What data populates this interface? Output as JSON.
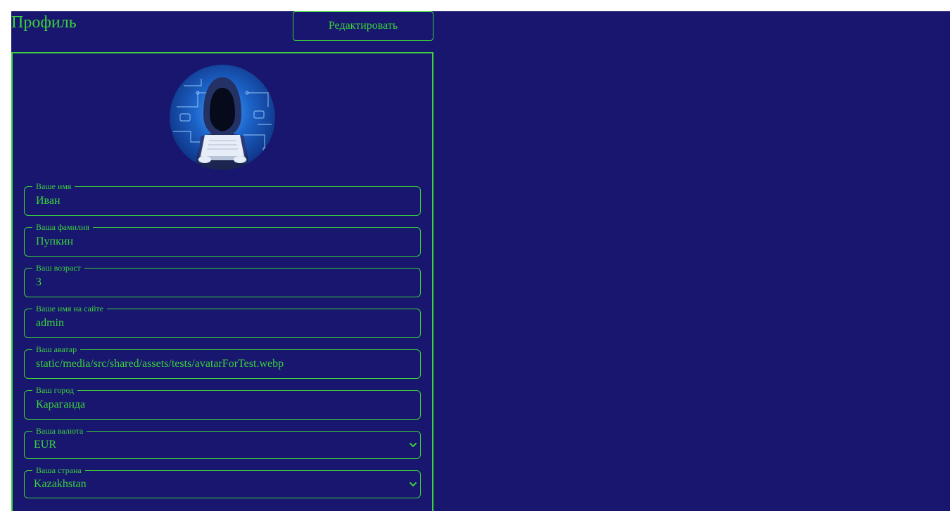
{
  "profile": {
    "title": "Профиль",
    "edit_label": "Редактировать"
  },
  "fields": [
    {
      "label": "Ваше имя",
      "value": "Иван"
    },
    {
      "label": "Ваша фамилия",
      "value": "Пупкин"
    },
    {
      "label": "Ваш возраст",
      "value": "3"
    },
    {
      "label": "Ваше имя на сайте",
      "value": "admin"
    },
    {
      "label": "Ваш аватар",
      "value": "static/media/src/shared/assets/tests/avatarForTest.webp"
    },
    {
      "label": "Ваш город",
      "value": "Караганда"
    }
  ],
  "selects": [
    {
      "label": "Ваша валюта",
      "value": "EUR"
    },
    {
      "label": "Ваша страна",
      "value": "Kazakhstan"
    }
  ],
  "avatar_icon": "hooded-hacker-avatar",
  "colors": {
    "background": "#18166f",
    "accent": "#3bd23b",
    "page": "#ffffff"
  }
}
